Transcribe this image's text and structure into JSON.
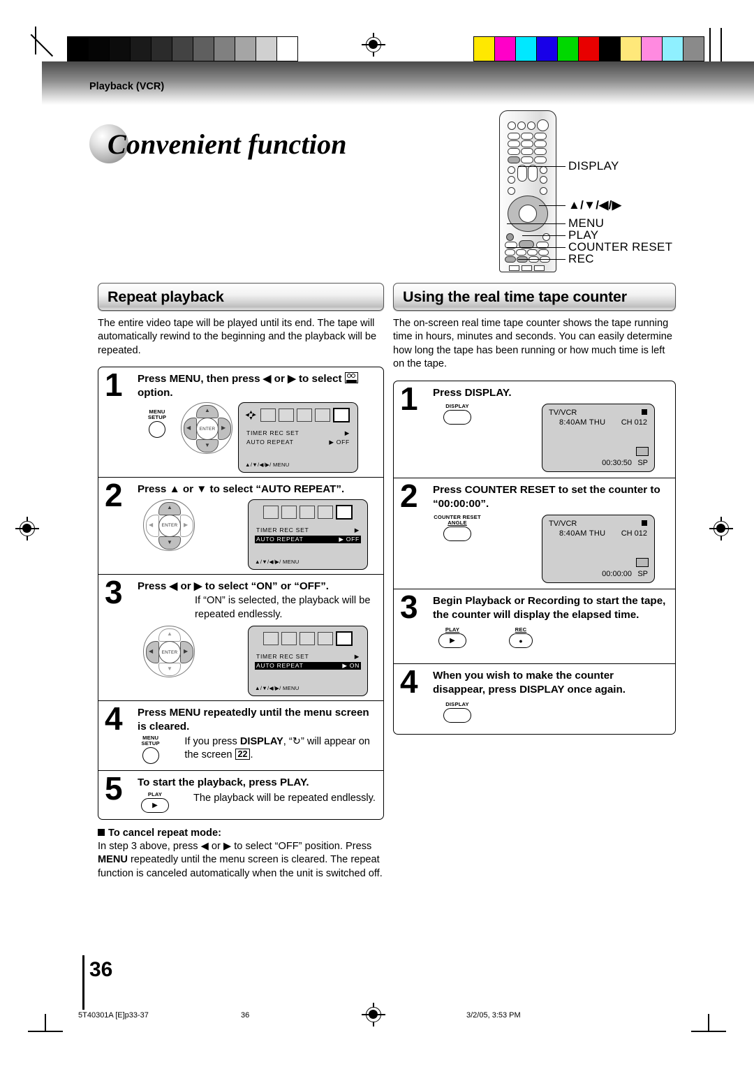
{
  "header": {
    "category": "Playback (VCR)",
    "title": "Convenient function"
  },
  "remote": {
    "labels": [
      "DISPLAY",
      "▲/▼/◀/▶",
      "MENU",
      "PLAY",
      "COUNTER RESET",
      "REC"
    ]
  },
  "left_section": {
    "heading": "Repeat playback",
    "intro": "The entire video tape will be played until its end. The tape will automatically rewind to the beginning and the playback will be repeated.",
    "steps": [
      {
        "number": "1",
        "title": "Press MENU, then press ◀ or ▶ to select",
        "title_tail": "option.",
        "button_caption": "MENU\nSETUP",
        "osd": {
          "rows": [
            {
              "label": "TIMER  REC  SET",
              "value": "▶",
              "highlight": false
            },
            {
              "label": "AUTO  REPEAT",
              "value": "▶ OFF",
              "highlight": false
            }
          ],
          "footer": "▲/▼/◀/▶/ MENU",
          "show_nav_diamond": true
        }
      },
      {
        "number": "2",
        "title": "Press ▲ or ▼ to select “AUTO REPEAT”.",
        "osd": {
          "rows": [
            {
              "label": "TIMER  REC  SET",
              "value": "▶",
              "highlight": false
            },
            {
              "label": "AUTO  REPEAT",
              "value": "▶ OFF",
              "highlight": true
            }
          ],
          "footer": "▲/▼/◀/▶/ MENU",
          "show_nav_diamond": false
        }
      },
      {
        "number": "3",
        "title": "Press ◀ or ▶ to select “ON” or “OFF”.",
        "body": "If “ON” is selected, the playback will be repeated endlessly.",
        "osd": {
          "rows": [
            {
              "label": "TIMER  REC  SET",
              "value": "▶",
              "highlight": false
            },
            {
              "label": "AUTO  REPEAT",
              "value": "▶ ON",
              "highlight": true
            }
          ],
          "footer": "▲/▼/◀/▶/ MENU",
          "show_nav_diamond": false
        }
      },
      {
        "number": "4",
        "title": "Press MENU repeatedly until the menu screen is cleared.",
        "body_pre": "If you press ",
        "body_bold": "DISPLAY",
        "body_mid": ", “↻” will appear on the screen ",
        "page_ref": "22",
        "body_post": ".",
        "button_caption": "MENU\nSETUP"
      },
      {
        "number": "5",
        "title": "To start the playback, press PLAY.",
        "body": "The playback will be repeated endlessly.",
        "button_caption": "PLAY",
        "button_glyph": "▶"
      }
    ],
    "note": {
      "heading": "To cancel repeat mode",
      "text_pre": "In step 3 above, press ◀ or ▶ to select “OFF” position. Press ",
      "bold": "MENU",
      "text_post": " repeatedly until the menu screen is cleared. The repeat function is canceled automatically when the unit is switched off."
    }
  },
  "right_section": {
    "heading": "Using the real time tape counter",
    "intro": "The on-screen real time tape counter shows the tape running time in hours, minutes and seconds. You can easily determine how long the tape has been running or how much time is left on the tape.",
    "steps": [
      {
        "number": "1",
        "title": "Press DISPLAY.",
        "button_caption": "DISPLAY",
        "screen": {
          "source": "TV/VCR",
          "time": "8:40AM  THU",
          "channel": "CH 012",
          "counter": "00:30:50",
          "speed": "SP"
        }
      },
      {
        "number": "2",
        "title": "Press COUNTER RESET to set the counter to “00:00:00”.",
        "button_caption": "COUNTER RESET",
        "button_caption2": "ANGLE",
        "screen": {
          "source": "TV/VCR",
          "time": "8:40AM  THU",
          "channel": "CH 012",
          "counter": "00:00:00",
          "speed": "SP"
        }
      },
      {
        "number": "3",
        "title": "Begin Playback or Recording to start the tape, the counter will display the elapsed time.",
        "button_caption": "PLAY",
        "button_glyph": "▶",
        "button_caption_b": "REC",
        "button_glyph_b": "●"
      },
      {
        "number": "4",
        "title": "When you wish to make the counter disappear, press DISPLAY once again.",
        "button_caption": "DISPLAY"
      }
    ]
  },
  "footer": {
    "page_number": "36",
    "part_code": "5T40301A [E]p33-37",
    "center_page": "36",
    "timestamp": "3/2/05, 3:53 PM"
  },
  "colorbars": {
    "gray": [
      "#000000",
      "#050505",
      "#0c0c0c",
      "#1a1a1a",
      "#2b2b2b",
      "#434343",
      "#5f5f5f",
      "#808080",
      "#a5a5a5",
      "#d0d0d0",
      "#ffffff"
    ],
    "color": [
      "#ffe800",
      "#ff00c8",
      "#00e8ff",
      "#1800e8",
      "#00d800",
      "#e80000",
      "#000000",
      "#ffe87a",
      "#ff8ae0",
      "#8ff0ff",
      "#8a8a8a"
    ]
  }
}
